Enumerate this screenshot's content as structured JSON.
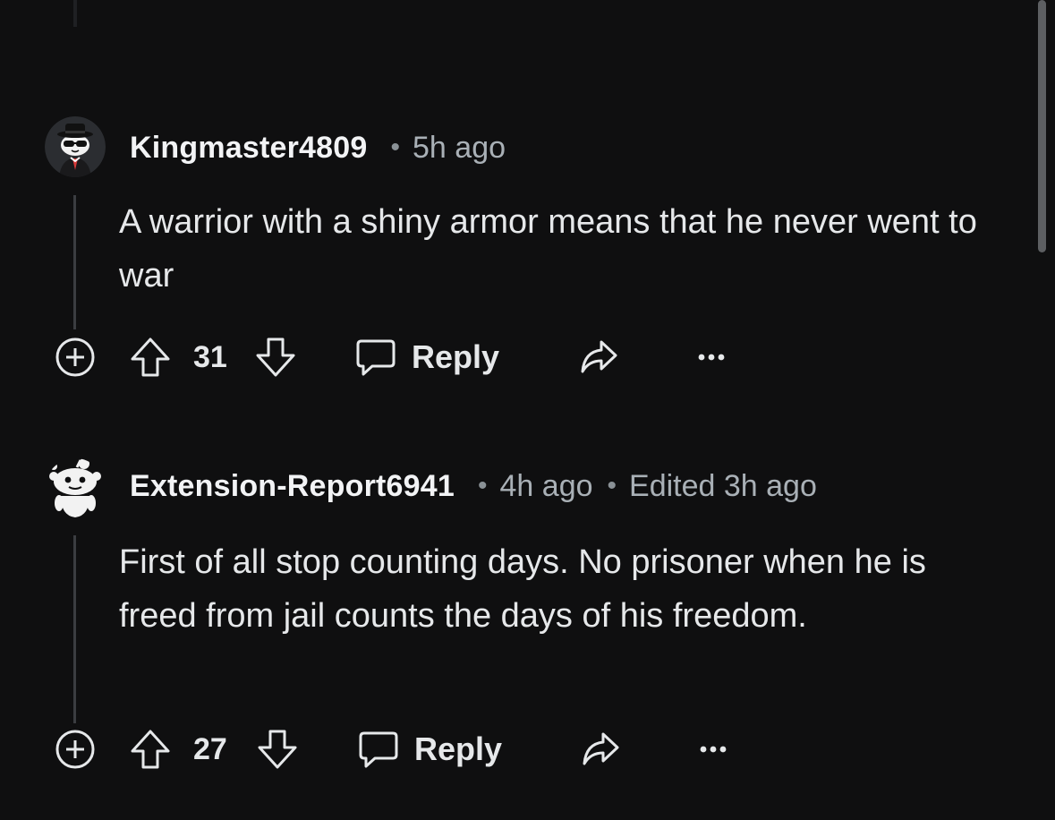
{
  "comments": [
    {
      "username": "Kingmaster4809",
      "separator": "•",
      "time": "5h ago",
      "edited": "",
      "text": "A warrior with a shiny armor means that he never went to war",
      "score": "31",
      "reply_label": "Reply",
      "avatar": "snoo-top-hat-sunglasses-avatar"
    },
    {
      "username": "Extension-Report6941",
      "separator": "•",
      "time": "4h ago",
      "edited_separator": "•",
      "edited": "Edited 3h ago",
      "text": "First of all stop counting days. No prisoner when he is freed from jail counts the days of his freedom.",
      "score": "27",
      "reply_label": "Reply",
      "avatar": "snoo-default-white-avatar"
    }
  ],
  "icons": {
    "expand": "plus-circle-icon",
    "upvote": "upvote-arrow-icon",
    "downvote": "downvote-arrow-icon",
    "reply": "speech-bubble-icon",
    "share": "share-arrow-icon",
    "more": "more-horizontal-icon"
  },
  "colors": {
    "background": "#0f0f10",
    "text": "#e6e8ea",
    "muted": "#a9b0b6",
    "thread_line": "#3b3d41"
  }
}
